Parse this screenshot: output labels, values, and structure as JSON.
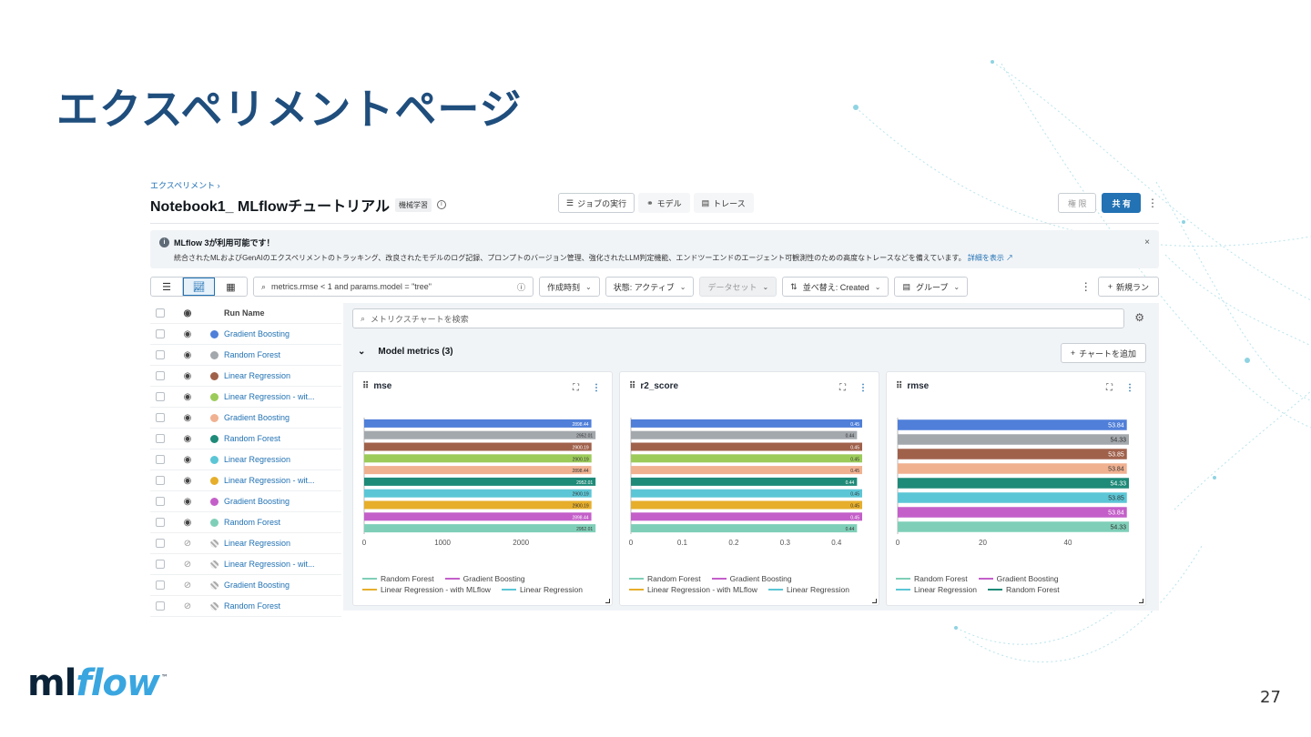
{
  "slide": {
    "title": "エクスペリメントページ",
    "page_number": "27",
    "logo_ml": "ml",
    "logo_flow": "flow",
    "logo_tm": "™"
  },
  "app": {
    "breadcrumb": "エクスペリメント  ›",
    "experiment_title": "Notebook1_ MLflowチュートリアル",
    "tag": "機械学習",
    "view_tabs": [
      {
        "label": "ジョブの実行",
        "icon": "list-icon"
      },
      {
        "label": "モデル",
        "icon": "models-icon"
      },
      {
        "label": "トレース",
        "icon": "trace-icon"
      }
    ],
    "permissions_label": "権 限",
    "share_label": "共 有",
    "banner": {
      "title": "MLflow 3が利用可能です！",
      "text": "統合されたMLおよびGenAIのエクスペリメントのトラッキング、改良されたモデルのログ記録、プロンプトのバージョン管理、強化されたLLM判定機能、エンドツーエンドのエージェント可観測性のための高度なトレースなどを備えています。",
      "link": "詳細を表示 ↗",
      "close": "×"
    },
    "toolbar": {
      "search_value": "metrics.rmse < 1 and params.model = \"tree\"",
      "created_label": "作成時刻",
      "state_label": "状態: アクティブ",
      "dataset_label": "データセット",
      "sort_label": "並べ替え: Created",
      "group_label": "グループ",
      "new_run_label": "新規ラン"
    },
    "table": {
      "header": "Run Name",
      "rows": [
        {
          "name": "Gradient Boosting",
          "color": "#4f7fd9",
          "visible": true
        },
        {
          "name": "Random Forest",
          "color": "#a3a8ad",
          "visible": true
        },
        {
          "name": "Linear Regression",
          "color": "#a0614b",
          "visible": true
        },
        {
          "name": "Linear Regression - wit...",
          "color": "#9ccb5a",
          "visible": true
        },
        {
          "name": "Gradient Boosting",
          "color": "#f0b191",
          "visible": true
        },
        {
          "name": "Random Forest",
          "color": "#1e8a78",
          "visible": true
        },
        {
          "name": "Linear Regression",
          "color": "#5bc6d6",
          "visible": true
        },
        {
          "name": "Linear Regression - wit...",
          "color": "#e6ae2b",
          "visible": true
        },
        {
          "name": "Gradient Boosting",
          "color": "#c45fc9",
          "visible": true
        },
        {
          "name": "Random Forest",
          "color": "#7fcfb8",
          "visible": true
        },
        {
          "name": "Linear Regression",
          "color": "hatch",
          "visible": false
        },
        {
          "name": "Linear Regression - wit...",
          "color": "hatch",
          "visible": false
        },
        {
          "name": "Gradient Boosting",
          "color": "hatch",
          "visible": false
        },
        {
          "name": "Random Forest",
          "color": "hatch",
          "visible": false
        }
      ]
    },
    "charts_panel": {
      "search_placeholder": "メトリクスチャートを検索",
      "section_title": "Model metrics (3)",
      "add_chart_label": "チャートを追加"
    }
  },
  "chart_data": [
    {
      "type": "bar",
      "orientation": "horizontal",
      "title": "mse",
      "xlim": [
        0,
        2950
      ],
      "xticks": [
        0,
        1000,
        2000
      ],
      "values": [
        2898.44,
        2952.01,
        2900.19,
        2900.19,
        2898.44,
        2952.01,
        2900.19,
        2900.19,
        2898.44,
        2952.01
      ],
      "labels": [
        "2898.44",
        "2952.01",
        "2900.19",
        "2900.19",
        "2898.44",
        "2952.01",
        "2900.19",
        "2900.19",
        "2898.44",
        "2952.01"
      ],
      "colors": [
        "#4f7fd9",
        "#a3a8ad",
        "#a0614b",
        "#9ccb5a",
        "#f0b191",
        "#1e8a78",
        "#5bc6d6",
        "#e6ae2b",
        "#c45fc9",
        "#7fcfb8"
      ],
      "legend": [
        {
          "name": "Random Forest",
          "color": "#7fcfb8"
        },
        {
          "name": "Gradient Boosting",
          "color": "#c45fc9"
        },
        {
          "name": "Linear Regression - with MLflow",
          "color": "#e6ae2b"
        },
        {
          "name": "Linear Regression",
          "color": "#5bc6d6"
        }
      ]
    },
    {
      "type": "bar",
      "orientation": "horizontal",
      "title": "r2_score",
      "xlim": [
        0,
        0.45
      ],
      "xticks": [
        0,
        0.1,
        0.2,
        0.3,
        0.4
      ],
      "values": [
        0.45,
        0.44,
        0.45,
        0.45,
        0.45,
        0.44,
        0.45,
        0.45,
        0.45,
        0.44
      ],
      "labels": [
        "0.45",
        "0.44",
        "0.45",
        "0.45",
        "0.45",
        "0.44",
        "0.45",
        "0.45",
        "0.45",
        "0.44"
      ],
      "colors": [
        "#4f7fd9",
        "#a3a8ad",
        "#a0614b",
        "#9ccb5a",
        "#f0b191",
        "#1e8a78",
        "#5bc6d6",
        "#e6ae2b",
        "#c45fc9",
        "#7fcfb8"
      ],
      "legend": [
        {
          "name": "Random Forest",
          "color": "#7fcfb8"
        },
        {
          "name": "Gradient Boosting",
          "color": "#c45fc9"
        },
        {
          "name": "Linear Regression - with MLflow",
          "color": "#e6ae2b"
        },
        {
          "name": "Linear Regression",
          "color": "#5bc6d6"
        }
      ]
    },
    {
      "type": "bar",
      "orientation": "horizontal",
      "title": "rmse",
      "xlim": [
        0,
        54.33
      ],
      "xticks": [
        0,
        20,
        40
      ],
      "values": [
        53.84,
        54.33,
        53.85,
        53.84,
        54.33,
        53.85,
        53.84,
        54.33
      ],
      "labels": [
        "53.84",
        "54.33",
        "53.85",
        "53.84",
        "54.33",
        "53.85",
        "53.84",
        "54.33"
      ],
      "colors": [
        "#4f7fd9",
        "#a3a8ad",
        "#a0614b",
        "#f0b191",
        "#1e8a78",
        "#5bc6d6",
        "#c45fc9",
        "#7fcfb8"
      ],
      "legend": [
        {
          "name": "Random Forest",
          "color": "#7fcfb8"
        },
        {
          "name": "Gradient Boosting",
          "color": "#c45fc9"
        },
        {
          "name": "Linear Regression",
          "color": "#5bc6d6"
        },
        {
          "name": "Random Forest",
          "color": "#1e8a78"
        }
      ]
    }
  ]
}
